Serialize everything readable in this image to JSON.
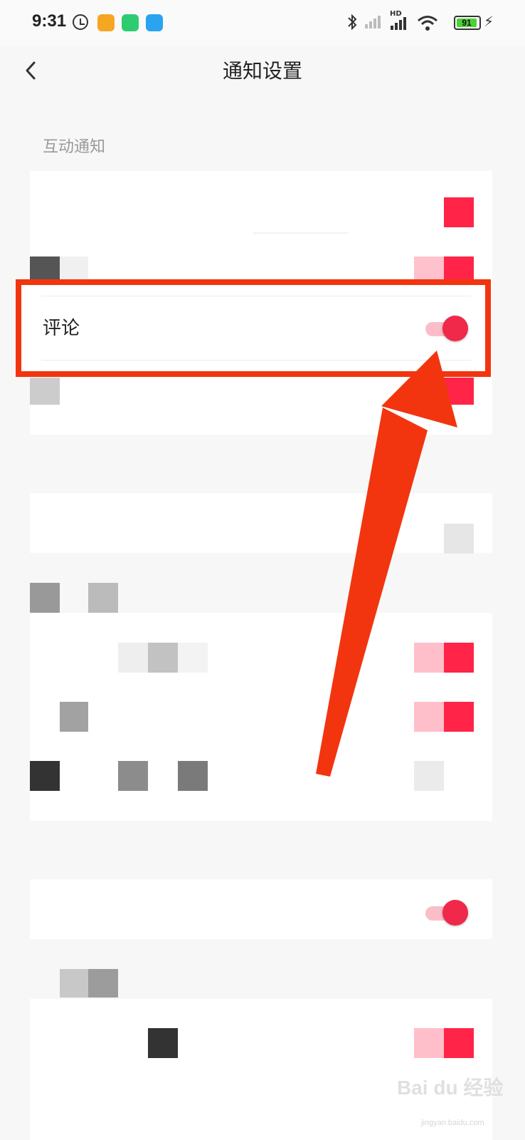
{
  "status_bar": {
    "time": "9:31",
    "network_label": "HD",
    "battery_level": "91",
    "icons": [
      "alarm-icon",
      "app-notification-icon",
      "security-app-icon",
      "cloud-app-icon",
      "bluetooth-icon",
      "signal-icon",
      "wifi-icon",
      "battery-icon",
      "charging-icon"
    ]
  },
  "header": {
    "title": "通知设置",
    "back_icon": "chevron-left-icon"
  },
  "sections": [
    {
      "title": "互动通知",
      "highlighted_row": {
        "label": "评论",
        "toggle_on": true
      }
    }
  ],
  "annotation": {
    "color": "#f2350f"
  },
  "toggle_colors": {
    "on_knob": "#f0284a",
    "on_track": "#fbbdc8"
  },
  "watermark": {
    "brand": "Bai du 经验",
    "sub": "jingyan.baidu.com"
  }
}
